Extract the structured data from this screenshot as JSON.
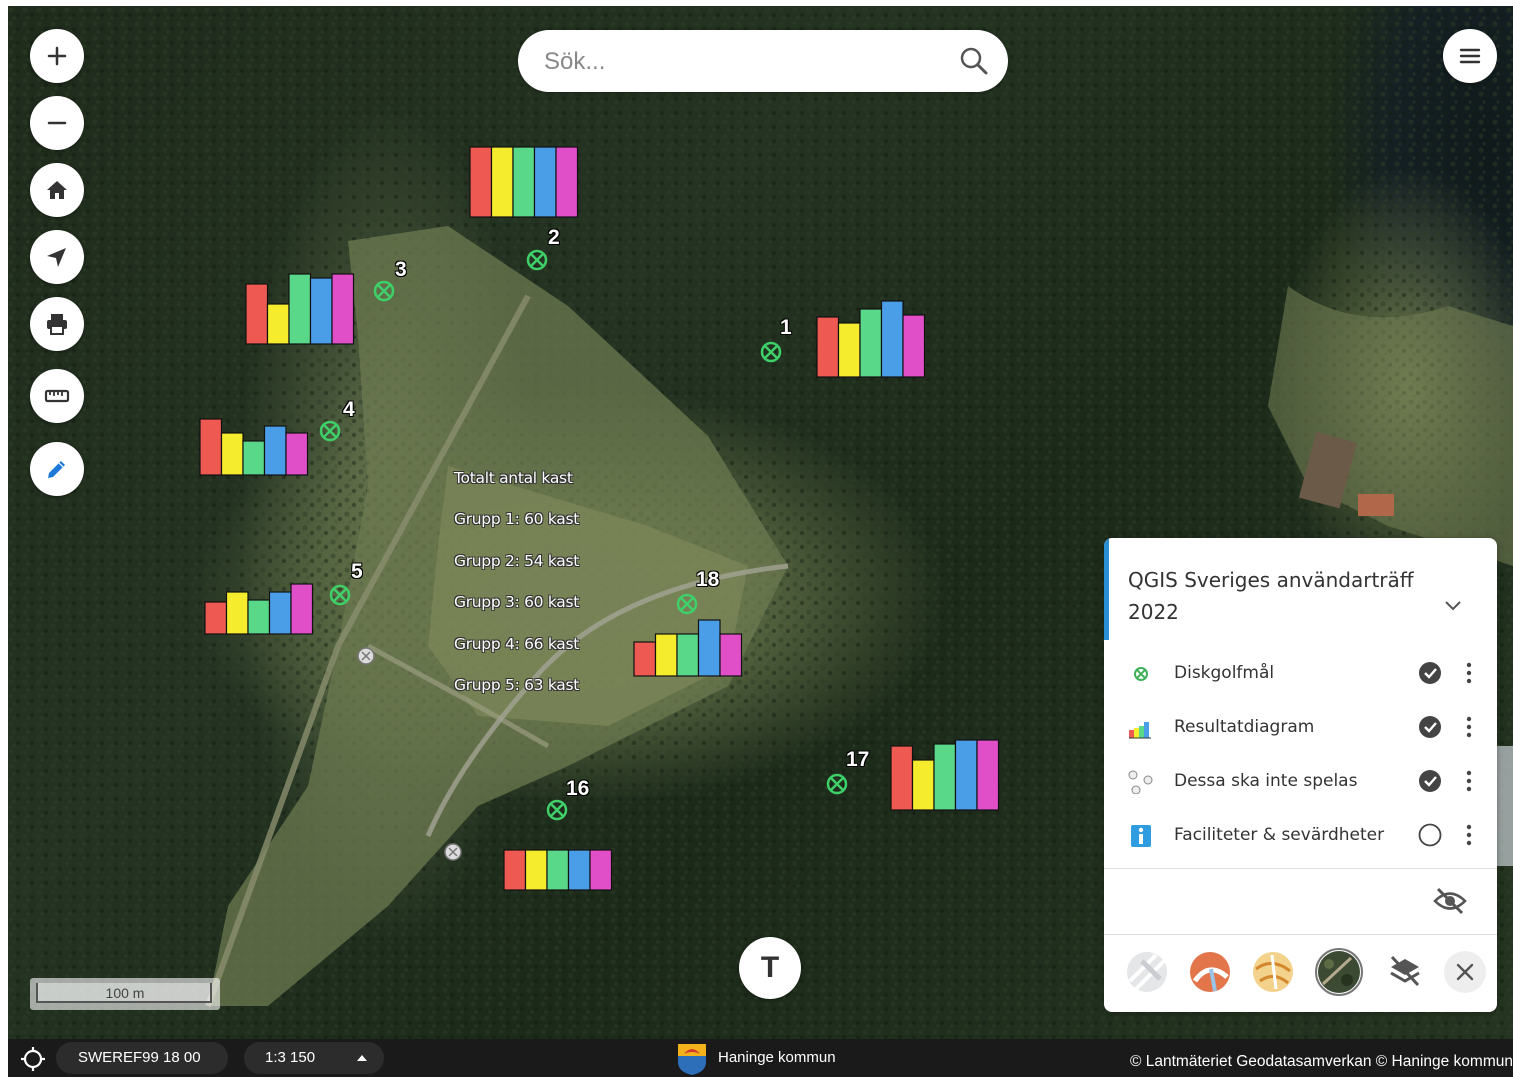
{
  "search": {
    "placeholder": "Sök..."
  },
  "toolbar": [
    {
      "name": "zoom-in-button",
      "icon": "plus-icon"
    },
    {
      "name": "zoom-out-button",
      "icon": "minus-icon"
    },
    {
      "name": "home-button",
      "icon": "home-icon"
    },
    {
      "name": "geolocate-button",
      "icon": "navigation-arrow-icon"
    },
    {
      "name": "print-button",
      "icon": "printer-icon"
    },
    {
      "name": "measure-button",
      "icon": "ruler-icon"
    },
    {
      "name": "draw-button",
      "icon": "pencil-icon"
    }
  ],
  "bar_colors": [
    "#ee5a52",
    "#f4ec2c",
    "#5ad88a",
    "#4a9ee8",
    "#e04ec8"
  ],
  "targets": [
    {
      "id": "1",
      "chart": [
        60,
        54,
        68,
        76,
        62
      ]
    },
    {
      "id": "2",
      "chart": [
        70,
        70,
        70,
        70,
        70
      ]
    },
    {
      "id": "3",
      "chart": [
        60,
        40,
        70,
        66,
        70
      ]
    },
    {
      "id": "4",
      "chart": [
        56,
        42,
        34,
        49,
        42
      ]
    },
    {
      "id": "5",
      "chart": [
        32,
        42,
        34,
        42,
        50
      ]
    },
    {
      "id": "16",
      "chart": [
        40,
        40,
        40,
        40,
        40
      ]
    },
    {
      "id": "17",
      "chart": [
        64,
        50,
        66,
        70,
        70
      ]
    },
    {
      "id": "18",
      "chart": [
        34,
        42,
        42,
        56,
        42
      ]
    }
  ],
  "summary": {
    "title": "Totalt antal kast",
    "rows": [
      "Grupp 1: 60 kast",
      "Grupp 2: 54 kast",
      "Grupp 3: 60 kast",
      "Grupp 4: 66 kast",
      "Grupp 5: 63 kast"
    ]
  },
  "scale_bar": {
    "label": "100 m"
  },
  "text_tool": {
    "label": "T"
  },
  "layer_panel": {
    "title": "QGIS Sveriges användarträff 2022",
    "layers": [
      {
        "name": "Diskgolfmål",
        "icon": "target-icon",
        "visible": true
      },
      {
        "name": "Resultatdiagram",
        "icon": "bar-chart-icon",
        "visible": true
      },
      {
        "name": "Dessa ska inte spelas",
        "icon": "grey-targets-icon",
        "visible": true
      },
      {
        "name": "Faciliteter & sevärdheter",
        "icon": "info-icon",
        "visible": false
      }
    ],
    "basemaps": [
      "grey-map",
      "orange-map",
      "topo-map",
      "orthophoto",
      "no-background"
    ],
    "active_basemap": "orthophoto"
  },
  "status_bar": {
    "projection": "SWEREF99 18 00",
    "scale": "1:3 150",
    "municipality": "Haninge kommun",
    "attribution": "© Lantmäteriet Geodatasamverkan © Haninge kommun"
  }
}
